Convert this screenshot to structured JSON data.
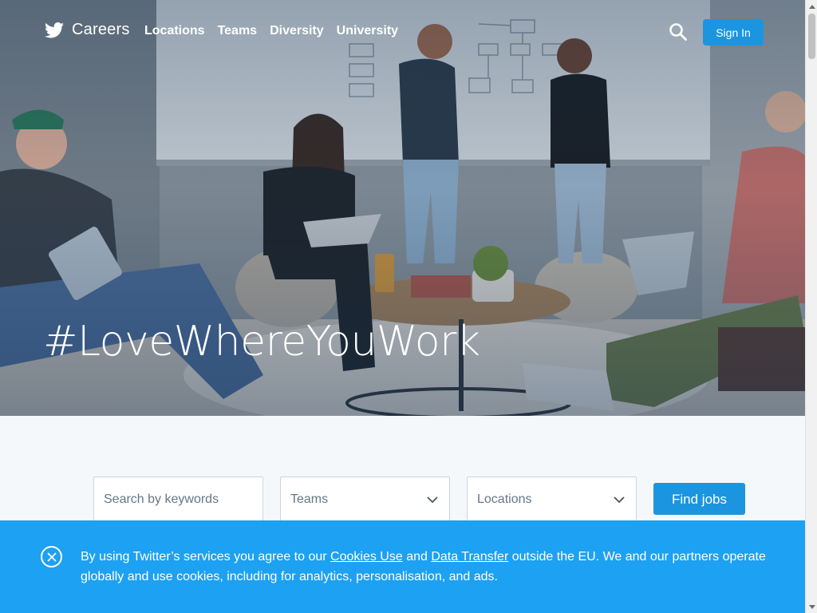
{
  "nav": {
    "brand": "Careers",
    "links": [
      "Locations",
      "Teams",
      "Diversity",
      "University"
    ],
    "sign_in": "Sign In",
    "icons": {
      "brand": "twitter-bird-icon",
      "search": "search-icon"
    }
  },
  "hero": {
    "headline": "#LoveWhereYouWork"
  },
  "search": {
    "keywords_placeholder": "Search by keywords",
    "teams_value": "Teams",
    "locations_value": "Locations",
    "find_button": "Find jobs"
  },
  "cookie": {
    "text_1": "By using Twitter’s services you agree to our ",
    "link_cookies": "Cookies Use",
    "text_2": " and ",
    "link_transfer": "Data Transfer",
    "text_3": " outside the EU. We and our partners operate globally and use cookies, including for analytics, personalisation, and ads."
  },
  "colors": {
    "accent": "#1b95e0",
    "banner": "#1da1f2",
    "page_bg": "#f5f8fa"
  }
}
